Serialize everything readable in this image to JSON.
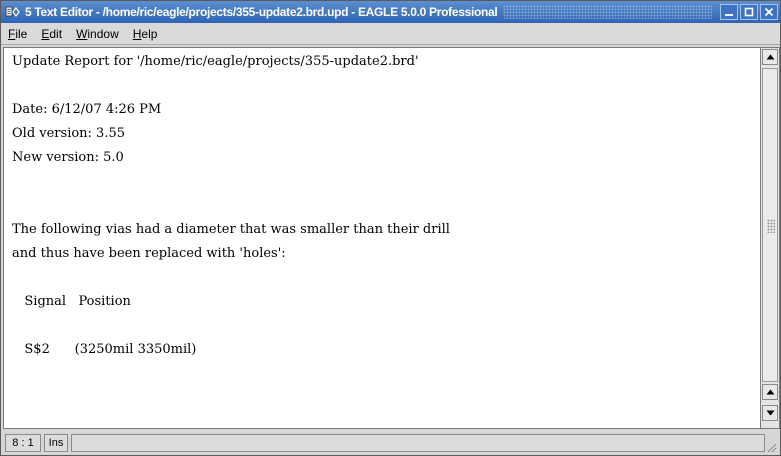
{
  "window": {
    "title": "5 Text Editor - /home/ric/eagle/projects/355-update2.brd.upd - EAGLE 5.0.0 Professional",
    "buttons": [
      "minimize",
      "maximize",
      "close"
    ],
    "colors": {
      "titlebar": "#3c70c0",
      "menubar": "#d9d9d9",
      "editor_bg": "#ffffff"
    }
  },
  "menu": {
    "items": [
      "File",
      "Edit",
      "Window",
      "Help"
    ],
    "mnemonics": [
      "F",
      "E",
      "W",
      "H"
    ]
  },
  "editor": {
    "lines": [
      "Update Report for '/home/ric/eagle/projects/355-update2.brd'",
      "",
      "Date: 6/12/07 4:26 PM",
      "Old version: 3.55",
      "New version: 5.0",
      "",
      "",
      "The following vias had a diameter that was smaller than their drill",
      "and thus have been replaced with 'holes':",
      "",
      "   Signal   Position",
      "",
      "   S$2      (3250mil 3350mil)"
    ]
  },
  "statusbar": {
    "position": "8 : 1",
    "mode": "Ins",
    "message": ""
  },
  "icons": {
    "app": "eagle-app-icon",
    "scroll_up": "arrow-up-icon",
    "scroll_down": "arrow-down-icon",
    "resize": "resize-grip-icon"
  }
}
